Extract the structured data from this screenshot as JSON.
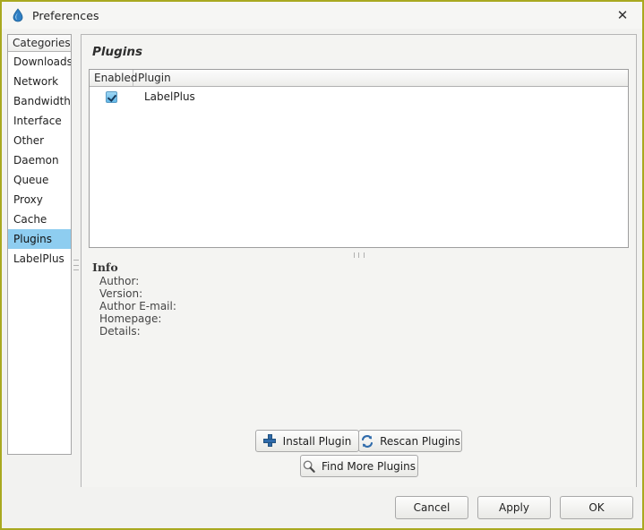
{
  "window": {
    "title": "Preferences",
    "icon": "droplet-icon",
    "close_label": "✕",
    "border_color": "#a9a920"
  },
  "sidebar": {
    "header": "Categories",
    "selected": "Plugins",
    "items": [
      {
        "label": "Downloads"
      },
      {
        "label": "Network"
      },
      {
        "label": "Bandwidth"
      },
      {
        "label": "Interface"
      },
      {
        "label": "Other"
      },
      {
        "label": "Daemon"
      },
      {
        "label": "Queue"
      },
      {
        "label": "Proxy"
      },
      {
        "label": "Cache"
      },
      {
        "label": "Plugins"
      },
      {
        "label": "LabelPlus"
      }
    ]
  },
  "main": {
    "title": "Plugins",
    "table": {
      "columns": [
        {
          "label": "Enabled"
        },
        {
          "label": "Plugin"
        }
      ],
      "rows": [
        {
          "enabled": true,
          "name": "LabelPlus"
        }
      ]
    },
    "info": {
      "heading": "Info",
      "fields": [
        {
          "label": "Author:"
        },
        {
          "label": "Version:"
        },
        {
          "label": "Author E-mail:"
        },
        {
          "label": "Homepage:"
        },
        {
          "label": "Details:"
        }
      ]
    },
    "actions": {
      "install": "Install Plugin",
      "rescan": "Rescan Plugins",
      "find": "Find More Plugins"
    }
  },
  "footer": {
    "cancel": "Cancel",
    "apply": "Apply",
    "ok": "OK"
  },
  "colors": {
    "selection": "#8ecdf0",
    "accent": "#2f6bab",
    "window_border": "#a9a920"
  }
}
